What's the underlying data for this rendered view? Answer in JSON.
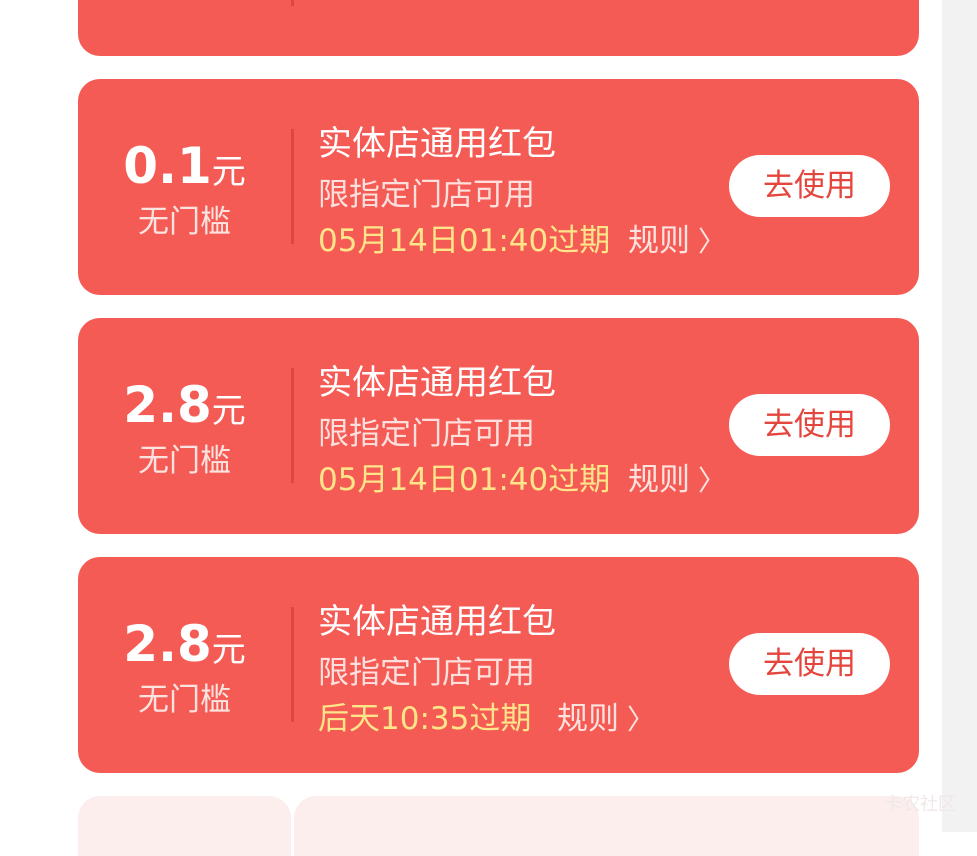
{
  "coupons": [
    {
      "amount": "0.1",
      "unit": "元",
      "threshold": "无门槛",
      "title": "实体店通用红包",
      "scope": "限指定门店可用",
      "expiry": "05月14日01:40过期",
      "rules_label": "规则",
      "button_label": "去使用"
    },
    {
      "amount": "2.8",
      "unit": "元",
      "threshold": "无门槛",
      "title": "实体店通用红包",
      "scope": "限指定门店可用",
      "expiry": "05月14日01:40过期",
      "rules_label": "规则",
      "button_label": "去使用"
    },
    {
      "amount": "2.8",
      "unit": "元",
      "threshold": "无门槛",
      "title": "实体店通用红包",
      "scope": "限指定门店可用",
      "expiry": "后天10:35过期",
      "rules_label": "规则",
      "button_label": "去使用"
    }
  ],
  "icons": {
    "rules": "chevron-right-icon"
  },
  "colors": {
    "card": "#f55b55",
    "expiry_text": "#ffe58a",
    "button_text": "#e4453d",
    "button_bg": "#ffffff"
  },
  "watermark": "卡农社区"
}
